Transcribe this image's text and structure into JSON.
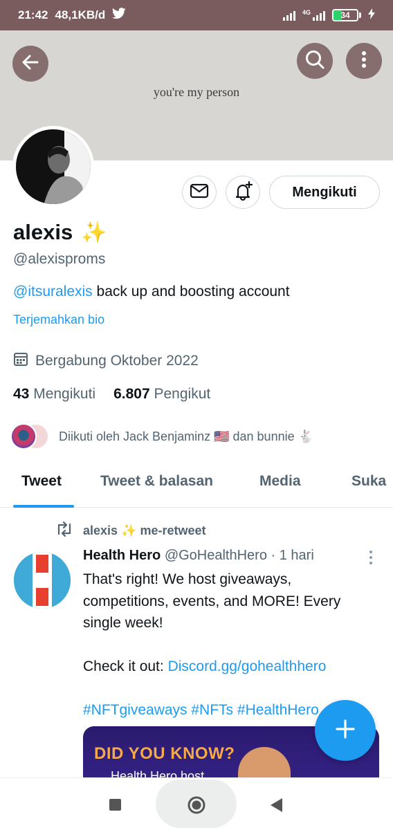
{
  "status_bar": {
    "time": "21:42",
    "speed": "48,1KB/d",
    "network": "4G",
    "battery": "34",
    "battery_level": 0.34
  },
  "header": {
    "banner_text": "you're my person"
  },
  "profile": {
    "name": "alexis",
    "name_emoji": "✨",
    "handle": "@alexisproms",
    "bio_mention": "@itsuralexis",
    "bio_rest": " back up and boosting account",
    "translate_label": "Terjemahkan bio",
    "joined": "Bergabung Oktober 2022",
    "following_count": "43",
    "following_label": "Mengikuti",
    "followers_count": "6.807",
    "followers_label": "Pengikut",
    "followed_by": "Diikuti oleh Jack Benjaminz 🇺🇸 dan bunnie 🐇",
    "follow_button_label": "Mengikuti"
  },
  "tabs": [
    {
      "label": "Tweet",
      "active": true
    },
    {
      "label": "Tweet & balasan",
      "active": false
    },
    {
      "label": "Media",
      "active": false
    },
    {
      "label": "Suka",
      "active": false
    }
  ],
  "tweet": {
    "retweeted_by": "alexis ✨ me-retweet",
    "author_name": "Health Hero",
    "author_handle": "@GoHealthHero",
    "time": "· 1 hari",
    "text_line1": "That's right! We host giveaways, competitions, events, and MORE! Every single week!\n\nCheck it out: ",
    "link": "Discord.gg/gohealthhero",
    "hashtags": "#NFTgiveaways #NFTs #HealthHero",
    "media_title": "DID YOU KNOW?",
    "media_subtitle": "Health Hero host"
  },
  "colors": {
    "accent": "#1d9bf0",
    "statusbar": "#7a5c5e",
    "header_button": "#6e5052"
  },
  "icons": {
    "back": "back-arrow-icon",
    "search": "search-icon",
    "more": "more-vertical-icon",
    "mail": "mail-icon",
    "notify": "bell-plus-icon",
    "calendar": "calendar-icon",
    "retweet": "retweet-icon",
    "compose": "plus-icon"
  }
}
